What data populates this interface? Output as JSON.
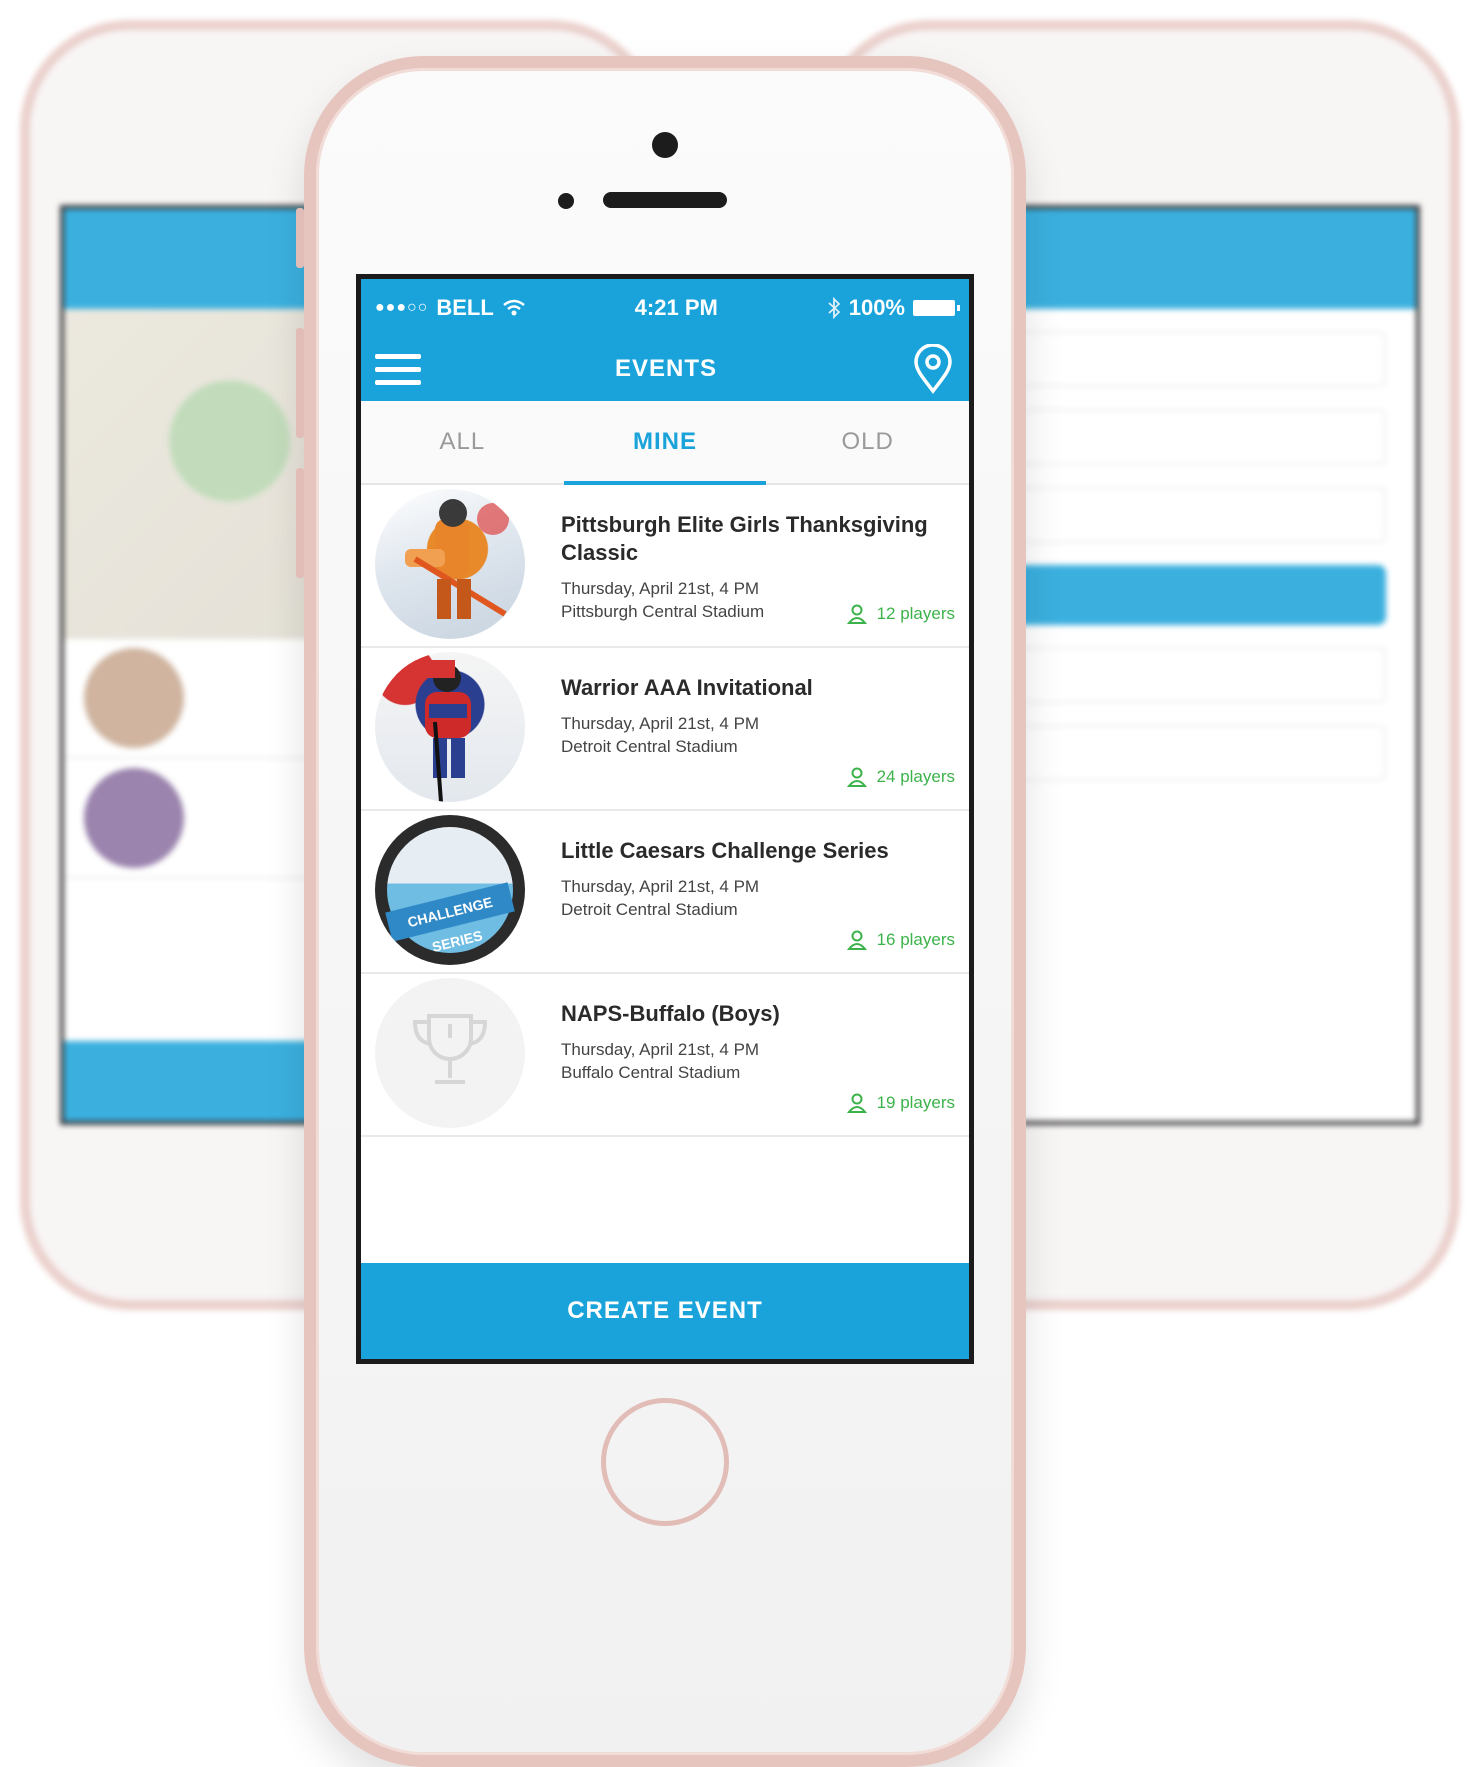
{
  "status_bar": {
    "signal": "●●●○○",
    "carrier": "BELL",
    "time": "4:21 PM",
    "battery": "100%"
  },
  "nav": {
    "title": "EVENTS"
  },
  "tabs": [
    {
      "label": "ALL",
      "active": false
    },
    {
      "label": "MINE",
      "active": true
    },
    {
      "label": "OLD",
      "active": false
    }
  ],
  "events": [
    {
      "title": "Pittsburgh Elite Girls Thanksgiving Classic",
      "date": "Thursday, April 21st, 4 PM",
      "venue": "Pittsburgh Central Stadium",
      "players": "12 players",
      "image": "hockey-goalie-photo"
    },
    {
      "title": "Warrior AAA Invitational",
      "date": "Thursday, April 21st, 4 PM",
      "venue": "Detroit Central Stadium",
      "players": "24 players",
      "image": "hockey-player-photo"
    },
    {
      "title": "Little Caesars Challenge Series",
      "date": "Thursday, April 21st, 4 PM",
      "venue": "Detroit Central Stadium",
      "players": "16 players",
      "image": "challenge-series-logo",
      "logo_text": "CHALLENGE SERIES"
    },
    {
      "title": "NAPS-Buffalo (Boys)",
      "date": "Thursday, April 21st, 4 PM",
      "venue": "Buffalo Central Stadium",
      "players": "19 players",
      "image": "trophy-placeholder-icon"
    }
  ],
  "create_button": "CREATE EVENT",
  "colors": {
    "primary": "#1aa3da",
    "players_green": "#3cb34a",
    "phone_frame": "#e7c5bf"
  }
}
